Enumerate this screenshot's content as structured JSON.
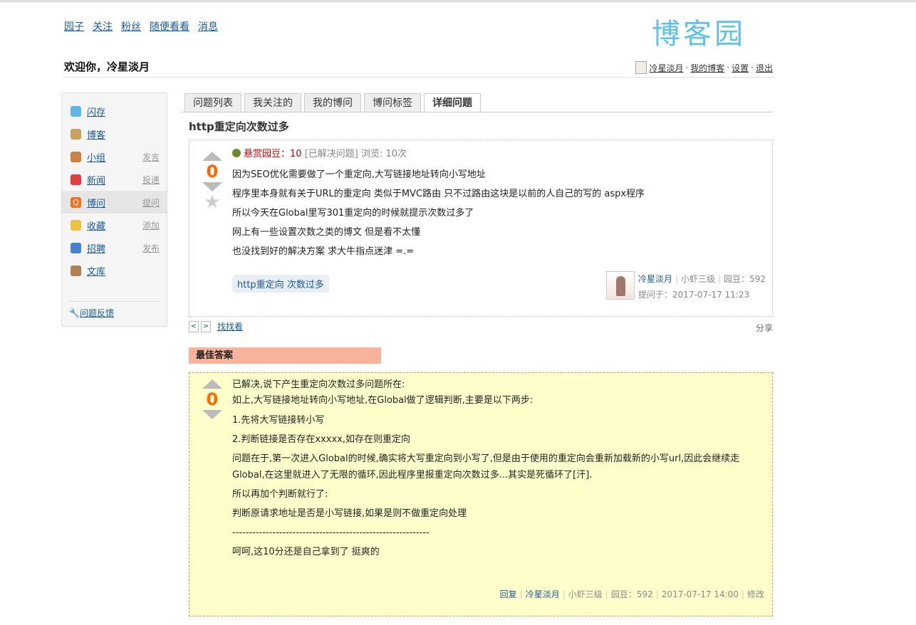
{
  "topnav": [
    "园子",
    "关注",
    "粉丝",
    "随便看看",
    "消息"
  ],
  "logo": "博客园",
  "welcome": "欢迎你，冷星淡月",
  "userbar": {
    "name": "冷星淡月",
    "blog": "我的博客",
    "settings": "设置",
    "logout": "退出"
  },
  "sidebar": {
    "items": [
      {
        "label": "闪存",
        "action": "",
        "icon": "chat-bubble-icon",
        "color": "#5bb8e8"
      },
      {
        "label": "博客",
        "action": "",
        "icon": "notepad-icon",
        "color": "#c8a060"
      },
      {
        "label": "小组",
        "action": "发言",
        "icon": "group-icon",
        "color": "#d08040"
      },
      {
        "label": "新闻",
        "action": "投递",
        "icon": "news-icon",
        "color": "#e04040"
      },
      {
        "label": "博问",
        "action": "提问",
        "icon": "question-q-icon",
        "color": "#f07020"
      },
      {
        "label": "收藏",
        "action": "添加",
        "icon": "favorite-icon",
        "color": "#f0c040"
      },
      {
        "label": "招聘",
        "action": "发布",
        "icon": "person-icon",
        "color": "#4a80d0"
      },
      {
        "label": "文库",
        "action": "",
        "icon": "book-icon",
        "color": "#b08050"
      }
    ],
    "feedback": "问题反馈"
  },
  "tabs": [
    "问题列表",
    "我关注的",
    "我的博问",
    "博问标签",
    "详细问题"
  ],
  "question": {
    "title": "http重定向次数过多",
    "reward_label": "悬赏园豆：",
    "reward": "10",
    "status": "[已解决问题]",
    "views": "浏览: 10次",
    "score": "0",
    "lines": [
      "因为SEO优化需要做了一个重定向,大写链接地址转向小写地址",
      "程序里本身就有关于URL的重定向 类似于MVC路由 只不过路由这块是以前的人自己的写的 aspx程序",
      "所以今天在Global里写301重定向的时候就提示次数过多了",
      "网上有一些设置次数之类的博文 但是看不太懂",
      "也没找到好的解决方案 求大牛指点迷津 =.="
    ],
    "tag": "http重定向 次数过多",
    "author": "冷星淡月",
    "level": "小虾三级",
    "beans": "园豆：592",
    "asked": "提问于：2017-07-17 11:23"
  },
  "pager": {
    "prev": "<",
    "next": ">",
    "look": "找找看",
    "share": "分享"
  },
  "best": {
    "header": "最佳答案",
    "score": "0",
    "lines": [
      "已解决,说下产生重定向次数过多问题所在:",
      "如上,大写链接地址转向小写地址,在Global做了逻辑判断,主要是以下两步:",
      "1.先将大写链接转小写",
      "2.判断链接是否存在xxxxx,如存在则重定向",
      "问题在于,第一次进入Global的时候,确实将大写重定向到小写了,但是由于使用的重定向会重新加载新的小写url,因此会继续走Global,在这里就进入了无限的循环,因此程序里报重定向次数过多...其实是死循环了[汗].",
      "所以再加个判断就行了:",
      "判断原请求地址是否是小写链接,如果是则不做重定向处理",
      "-----------------------------------------------------------",
      "呵呵,这10分还是自己拿到了 挺爽的"
    ],
    "reply": "回复",
    "author": "冷星淡月",
    "level": "小虾三级",
    "beans": "园豆：592",
    "time": "2017-07-17 14:00",
    "edit": "修改"
  }
}
